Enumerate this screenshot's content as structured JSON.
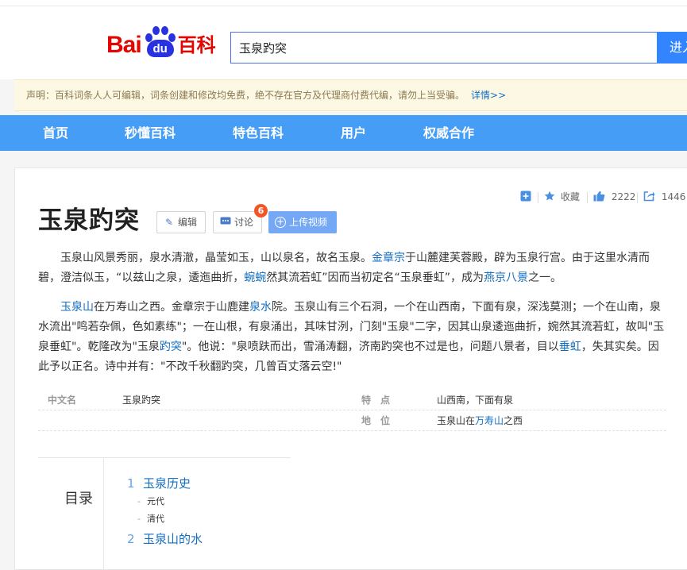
{
  "header": {
    "logo": {
      "bai": "Bai",
      "du": "du",
      "baike": "百科"
    },
    "search_value": "玉泉趵突",
    "search_button": "进入"
  },
  "notice": {
    "text": "声明：百科词条人人可编辑，词条创建和修改均免费，绝不存在官方及代理商付费代编，请勿上当受骗。",
    "link": "详情>>"
  },
  "nav": [
    "首页",
    "秒懂百科",
    "特色百科",
    "用户",
    "权威合作"
  ],
  "toolbar": {
    "collect_label": "收藏",
    "like_count": "2222",
    "share_count": "1446"
  },
  "entry": {
    "title": "玉泉趵突",
    "edit_label": "编辑",
    "discuss_label": "讨论",
    "discuss_badge": "6",
    "upload_label": "上传视频"
  },
  "paragraphs": {
    "p1": {
      "a": "玉泉山风景秀丽，泉水清澈，晶莹如玉，山以泉名，故名玉泉。",
      "link1": "金章宗",
      "b": "于山麓建芙蓉殿，辟为玉泉行宫。由于这里水清而碧，澄洁似玉，“以兹山之泉，逶迤曲折，",
      "link2": "蜿蜿",
      "c": "然其流若虹”因而当初定名“玉泉垂虹”，成为",
      "link3": "燕京八景",
      "d": "之一。"
    },
    "p2": {
      "link1": "玉泉山",
      "a": "在万寿山之西。金章宗于山鹿建",
      "link2": "泉水",
      "b": "院。玉泉山有三个石洞，一个在山西南，下面有泉，深浅莫测；一个在山南，泉水流出\"鸣若杂佩，色如素练\"；一在山根，有泉涌出，其味甘洌，门刻\"玉泉\"二字，因其山泉逶迤曲折，婉然其流若虹，故叫\"玉泉垂虹\"。乾隆改为\"玉泉",
      "link3": "趵突",
      "c": "\"。他说：\"泉喷趺而出，雪涌涛翻，济南趵突也不过是也，问题八景者，目以",
      "link4": "垂虹",
      "d": "，失其实矣。因此予以正名。诗中并有：\"不改千秋翻趵突，几曾百丈落云空!\""
    }
  },
  "basic_info": {
    "name_key": "中文名",
    "name_val": "玉泉趵突",
    "feature_key": "特　点",
    "feature_val": "山西南，下面有泉",
    "location_key": "地　位",
    "location_val_a": "玉泉山在",
    "location_val_link": "万寿山",
    "location_val_b": "之西"
  },
  "catalog": {
    "title": "目录",
    "items": [
      {
        "num": "1",
        "label": "玉泉历史"
      },
      {
        "sub": "元代"
      },
      {
        "sub": "清代"
      },
      {
        "num": "2",
        "label": "玉泉山的水"
      }
    ]
  }
}
